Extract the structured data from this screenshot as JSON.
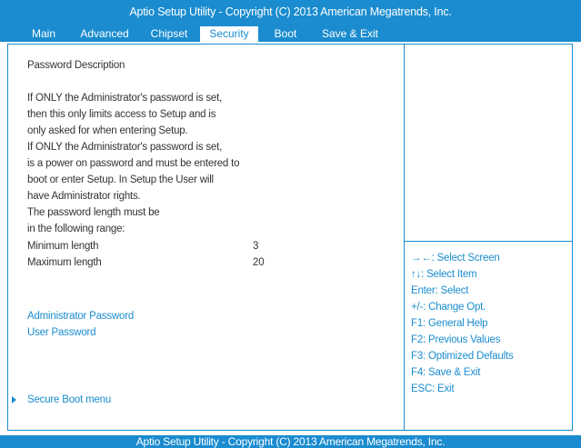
{
  "header": {
    "title": "Aptio Setup Utility - Copyright  (C)  2013 American Megatrends, Inc.",
    "tabs": [
      "Main",
      "Advanced",
      "Chipset",
      "Security",
      "Boot",
      "Save & Exit"
    ],
    "active_tab": "Security"
  },
  "main": {
    "description_title": "Password Description",
    "description_lines": [
      "If ONLY the Administrator's password is set,",
      "then this only limits access to Setup and is",
      "only asked for when entering Setup.",
      "If ONLY the Administrator's password is set,",
      "is a power on password and must be entered to",
      "boot or enter Setup. In Setup the User will",
      "have Administrator rights.",
      "The password length must be",
      "in the following range:"
    ],
    "min_length_label": "Minimum length",
    "min_length_value": "3",
    "max_length_label": "Maximum length",
    "max_length_value": "20",
    "admin_password_label": "Administrator Password",
    "user_password_label": "User Password",
    "secure_boot_label": "Secure Boot menu"
  },
  "help": {
    "items": [
      "→←: Select Screen",
      "↑↓: Select Item",
      "Enter: Select",
      "+/-: Change Opt.",
      "F1: General Help",
      "F2: Previous Values",
      "F3: Optimized Defaults",
      "F4: Save & Exit",
      "ESC: Exit"
    ]
  },
  "footer": {
    "title": "Aptio Setup Utility - Copyright  (C)  2013 American Megatrends, Inc."
  },
  "colors": {
    "accent": "#1a8ccf",
    "text": "#333333",
    "background": "#ffffff"
  }
}
